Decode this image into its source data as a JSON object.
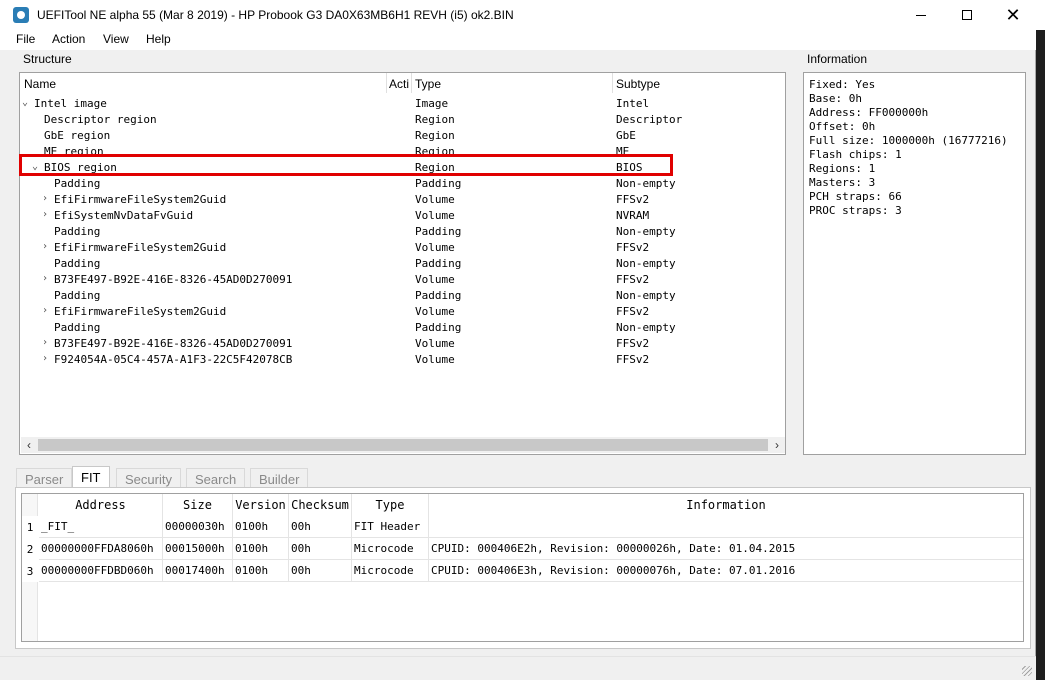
{
  "window": {
    "title": "UEFITool NE alpha 55 (Mar  8 2019) - HP Probook G3 DA0X63MB6H1 REVH (i5) ok2.BIN"
  },
  "menu": [
    "File",
    "Action",
    "View",
    "Help"
  ],
  "structure": {
    "label": "Structure",
    "columns": [
      "Name",
      "Action",
      "Type",
      "Subtype"
    ],
    "rows": [
      {
        "expander": "⌄",
        "name": "Intel image",
        "type": "Image",
        "subtype": "Intel"
      },
      {
        "expander": "",
        "name": "Descriptor region",
        "type": "Region",
        "subtype": "Descriptor"
      },
      {
        "expander": "",
        "name": "GbE region",
        "type": "Region",
        "subtype": "GbE"
      },
      {
        "expander": "",
        "name": "ME region",
        "type": "Region",
        "subtype": "ME"
      },
      {
        "expander": "⌄",
        "name": "BIOS region",
        "type": "Region",
        "subtype": "BIOS"
      },
      {
        "expander": "",
        "name": "Padding",
        "type": "Padding",
        "subtype": "Non-empty"
      },
      {
        "expander": "›",
        "name": "EfiFirmwareFileSystem2Guid",
        "type": "Volume",
        "subtype": "FFSv2"
      },
      {
        "expander": "›",
        "name": "EfiSystemNvDataFvGuid",
        "type": "Volume",
        "subtype": "NVRAM"
      },
      {
        "expander": "",
        "name": "Padding",
        "type": "Padding",
        "subtype": "Non-empty"
      },
      {
        "expander": "›",
        "name": "EfiFirmwareFileSystem2Guid",
        "type": "Volume",
        "subtype": "FFSv2"
      },
      {
        "expander": "",
        "name": "Padding",
        "type": "Padding",
        "subtype": "Non-empty"
      },
      {
        "expander": "›",
        "name": "B73FE497-B92E-416E-8326-45AD0D270091",
        "type": "Volume",
        "subtype": "FFSv2"
      },
      {
        "expander": "",
        "name": "Padding",
        "type": "Padding",
        "subtype": "Non-empty"
      },
      {
        "expander": "›",
        "name": "EfiFirmwareFileSystem2Guid",
        "type": "Volume",
        "subtype": "FFSv2"
      },
      {
        "expander": "",
        "name": "Padding",
        "type": "Padding",
        "subtype": "Non-empty"
      },
      {
        "expander": "›",
        "name": "B73FE497-B92E-416E-8326-45AD0D270091",
        "type": "Volume",
        "subtype": "FFSv2"
      },
      {
        "expander": "›",
        "name": "F924054A-05C4-457A-A1F3-22C5F42078CB",
        "type": "Volume",
        "subtype": "FFSv2"
      }
    ]
  },
  "information": {
    "label": "Information",
    "lines": [
      "Fixed: Yes",
      "Base: 0h",
      "Address: FF000000h",
      "Offset: 0h",
      "Full size: 1000000h (16777216)",
      "Flash chips: 1",
      "Regions: 1",
      "Masters: 3",
      "PCH straps: 66",
      "PROC straps: 3"
    ]
  },
  "tabs": [
    "Parser",
    "FIT",
    "Security",
    "Search",
    "Builder"
  ],
  "fit": {
    "columns": [
      "Address",
      "Size",
      "Version",
      "Checksum",
      "Type",
      "Information"
    ],
    "rows": [
      {
        "num": "1",
        "address": "_FIT_",
        "size": "00000030h",
        "version": "0100h",
        "checksum": "00h",
        "type": "FIT Header",
        "info": ""
      },
      {
        "num": "2",
        "address": "00000000FFDA8060h",
        "size": "00015000h",
        "version": "0100h",
        "checksum": "00h",
        "type": "Microcode",
        "info": "CPUID: 000406E2h, Revision: 00000026h, Date: 01.04.2015"
      },
      {
        "num": "3",
        "address": "00000000FFDBD060h",
        "size": "00017400h",
        "version": "0100h",
        "checksum": "00h",
        "type": "Microcode",
        "info": "CPUID: 000406E3h, Revision: 00000076h, Date: 07.01.2016"
      }
    ]
  }
}
